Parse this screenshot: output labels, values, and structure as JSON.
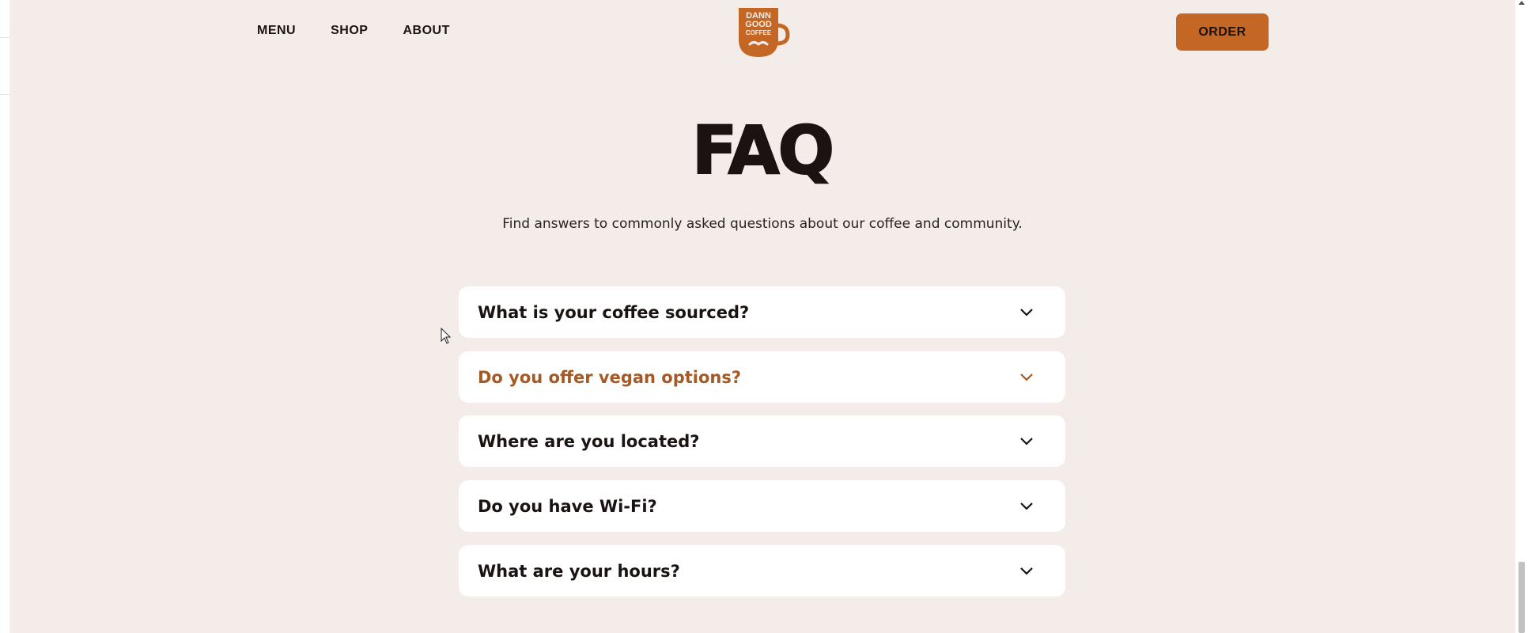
{
  "header": {
    "nav": [
      {
        "label": "MENU"
      },
      {
        "label": "SHOP"
      },
      {
        "label": "ABOUT"
      }
    ],
    "logo_text": [
      "DANN",
      "GOOD",
      "COFFEE"
    ],
    "order_label": "ORDER"
  },
  "faq": {
    "title": "FAQ",
    "subtitle": "Find answers to commonly asked questions about our coffee and community.",
    "items": [
      {
        "question": "What is your coffee sourced?",
        "state": "collapsed"
      },
      {
        "question": "Do you offer vegan options?",
        "state": "hover"
      },
      {
        "question": "Where are you located?",
        "state": "collapsed"
      },
      {
        "question": "Do you have Wi-Fi?",
        "state": "collapsed"
      },
      {
        "question": "What are your hours?",
        "state": "collapsed"
      }
    ]
  },
  "colors": {
    "background": "#f3ece8",
    "accent": "#c46624",
    "active_question": "#a55a25",
    "text": "#1a1311"
  },
  "icons": {
    "faq_toggle": "chevron-down-icon",
    "logo": "coffee-mug-logo-icon"
  }
}
